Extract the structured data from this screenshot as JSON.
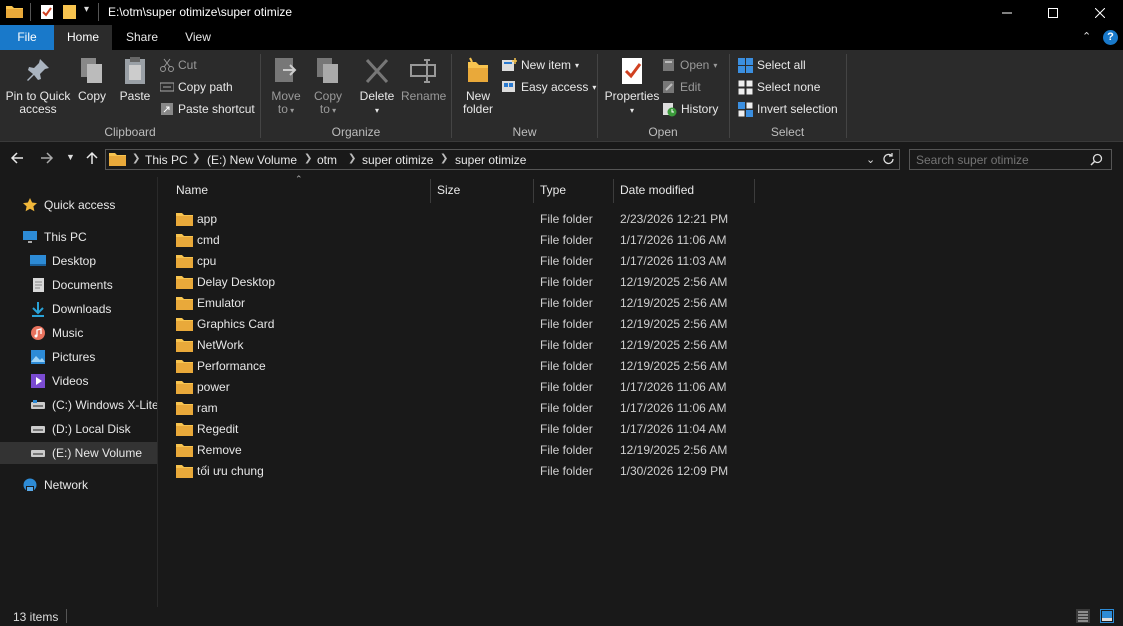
{
  "window": {
    "title": "E:\\otm\\super otimize\\super otimize",
    "minimize_icon": "minimize-icon",
    "maximize_icon": "maximize-icon",
    "close_icon": "close-icon"
  },
  "tabs": [
    {
      "label": "File"
    },
    {
      "label": "Home"
    },
    {
      "label": "Share"
    },
    {
      "label": "View"
    }
  ],
  "ribbon": {
    "clipboard": {
      "label": "Clipboard",
      "pin_line1": "Pin to Quick",
      "pin_line2": "access",
      "copy": "Copy",
      "paste": "Paste",
      "cut": "Cut",
      "copy_path": "Copy path",
      "paste_shortcut": "Paste shortcut"
    },
    "organize": {
      "label": "Organize",
      "move_line1": "Move",
      "move_line2": "to",
      "copy_line1": "Copy",
      "copy_line2": "to",
      "delete": "Delete",
      "rename": "Rename"
    },
    "new": {
      "label": "New",
      "folder_line1": "New",
      "folder_line2": "folder",
      "new_item": "New item",
      "easy_access": "Easy access"
    },
    "open": {
      "label": "Open",
      "properties": "Properties",
      "open": "Open",
      "edit": "Edit",
      "history": "History"
    },
    "select": {
      "label": "Select",
      "select_all": "Select all",
      "select_none": "Select none",
      "invert": "Invert selection"
    }
  },
  "address": {
    "crumbs": [
      "This PC",
      "(E:) New Volume",
      "otm",
      "super otimize",
      "super otimize"
    ],
    "search_placeholder": "Search super otimize"
  },
  "nav": {
    "quick_access": "Quick access",
    "this_pc": "This PC",
    "desktop": "Desktop",
    "documents": "Documents",
    "downloads": "Downloads",
    "music": "Music",
    "pictures": "Pictures",
    "videos": "Videos",
    "c_drive": "(C:) Windows X-Lite",
    "d_drive": "(D:) Local Disk",
    "e_drive": "(E:) New Volume",
    "network": "Network"
  },
  "columns": {
    "name": "Name",
    "size": "Size",
    "type": "Type",
    "date": "Date modified"
  },
  "files": [
    {
      "name": "app",
      "type": "File folder",
      "date": "2/23/2026 12:21 PM"
    },
    {
      "name": "cmd",
      "type": "File folder",
      "date": "1/17/2026 11:06 AM"
    },
    {
      "name": "cpu",
      "type": "File folder",
      "date": "1/17/2026 11:03 AM"
    },
    {
      "name": "Delay Desktop",
      "type": "File folder",
      "date": "12/19/2025 2:56 AM"
    },
    {
      "name": "Emulator",
      "type": "File folder",
      "date": "12/19/2025 2:56 AM"
    },
    {
      "name": "Graphics Card",
      "type": "File folder",
      "date": "12/19/2025 2:56 AM"
    },
    {
      "name": "NetWork",
      "type": "File folder",
      "date": "12/19/2025 2:56 AM"
    },
    {
      "name": "Performance",
      "type": "File folder",
      "date": "12/19/2025 2:56 AM"
    },
    {
      "name": "power",
      "type": "File folder",
      "date": "1/17/2026 11:06 AM"
    },
    {
      "name": "ram",
      "type": "File folder",
      "date": "1/17/2026 11:06 AM"
    },
    {
      "name": "Regedit",
      "type": "File folder",
      "date": "1/17/2026 11:04 AM"
    },
    {
      "name": "Remove",
      "type": "File folder",
      "date": "12/19/2025 2:56 AM"
    },
    {
      "name": "tối ưu chung",
      "type": "File folder",
      "date": "1/30/2026 12:09 PM"
    }
  ],
  "status": {
    "count": "13 items"
  },
  "colors": {
    "file_tab": "#1979ca",
    "folder": "#f8c44f",
    "background": "#191919"
  }
}
